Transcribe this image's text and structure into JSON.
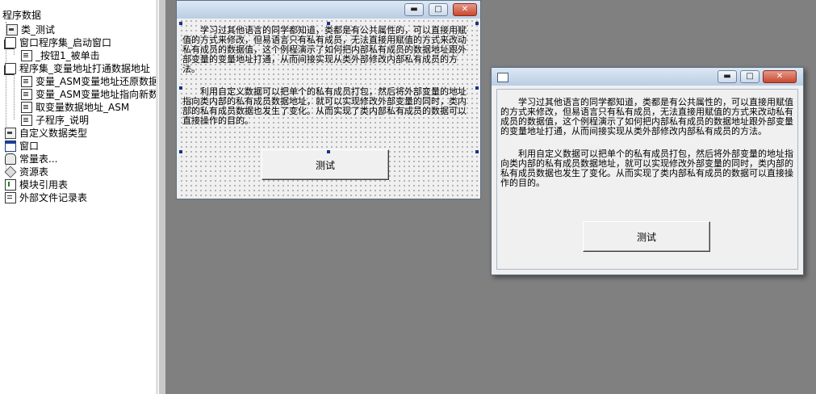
{
  "tree": {
    "root": "程序数据",
    "items": [
      {
        "label": "类_测试",
        "icon": "class-icon"
      },
      {
        "label": "窗口程序集_启动窗口",
        "icon": "assembly-icon"
      },
      {
        "label": "_按钮1_被单击",
        "icon": "subprogram-icon"
      },
      {
        "label": "程序集_变量地址打通数据地址",
        "icon": "assembly-icon"
      },
      {
        "label": "变量_ASM变量地址还原数据",
        "icon": "subprogram-icon"
      },
      {
        "label": "变量_ASM变量地址指向新数",
        "icon": "subprogram-icon"
      },
      {
        "label": "取变量数据地址_ASM",
        "icon": "subprogram-icon"
      },
      {
        "label": "子程序_说明",
        "icon": "subprogram-icon"
      },
      {
        "label": "自定义数据类型",
        "icon": "class-icon"
      },
      {
        "label": "窗口",
        "icon": "window-icon"
      },
      {
        "label": "常量表...",
        "icon": "database-icon"
      },
      {
        "label": "资源表",
        "icon": "resource-icon"
      },
      {
        "label": "模块引用表",
        "icon": "module-icon"
      },
      {
        "label": "外部文件记录表",
        "icon": "file-icon"
      }
    ]
  },
  "design_window": {
    "para1": "学习过其他语言的同学都知道，类都是有公共属性的，可以直接用赋值的方式来修改，但易语言只有私有成员，无法直接用赋值的方式来改动私有成员的数据值，这个例程演示了如何把内部私有成员的数据地址跟外部变量的变量地址打通，从而间接实现从类外部修改内部私有成员的方法。",
    "para2": "利用自定义数据可以把单个的私有成员打包，然后将外部变量的地址指向类内部的私有成员数据地址，就可以实现修改外部变量的同时，类内部的私有成员数据也发生了变化。从而实现了类内部私有成员的数据可以直接操作的目的。",
    "button_label": "测试"
  },
  "preview_window": {
    "para1": "学习过其他语言的同学都知道，类都是有公共属性的，可以直接用赋值的方式来修改，但易语言只有私有成员，无法直接用赋值的方式来改动私有成员的数据值，这个例程演示了如何把内部私有成员的数据地址跟外部变量的变量地址打通，从而间接实现从类外部修改内部私有成员的方法。",
    "para2": "利用自定义数据可以把单个的私有成员打包，然后将外部变量的地址指向类内部的私有成员数据地址，就可以实现修改外部变量的同时，类内部的私有成员数据也发生了变化。从而实现了类内部私有成员的数据可以直接操作的目的。",
    "button_label": "测试"
  },
  "window_controls": {
    "minimize": "▬",
    "maximize": "□",
    "close": "✕"
  }
}
